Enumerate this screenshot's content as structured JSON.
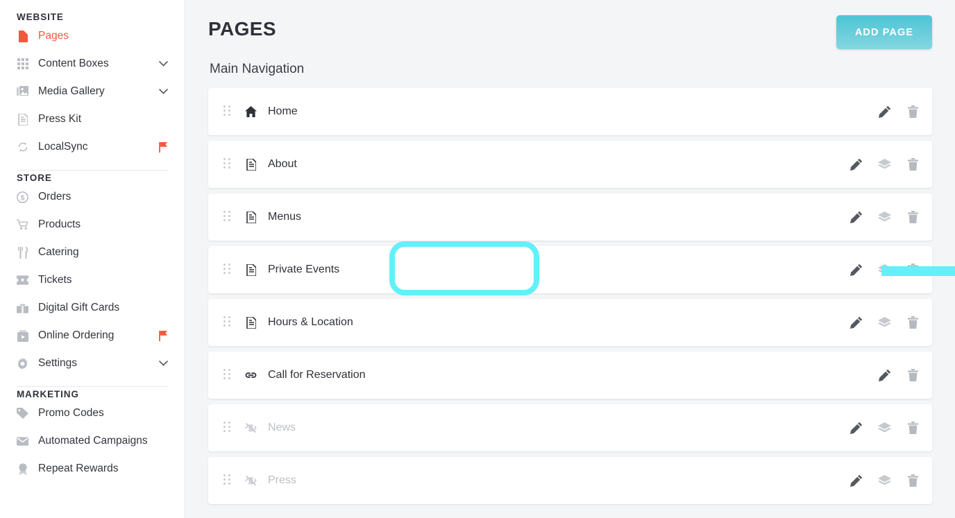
{
  "sidebar": {
    "sections": [
      {
        "title": "WEBSITE",
        "items": [
          {
            "label": "Pages",
            "icon": "page-filled-icon",
            "active": true,
            "trailing": "none"
          },
          {
            "label": "Content Boxes",
            "icon": "grid-icon",
            "active": false,
            "trailing": "chevron-down-icon"
          },
          {
            "label": "Media Gallery",
            "icon": "image-stack-icon",
            "active": false,
            "trailing": "chevron-down-icon"
          },
          {
            "label": "Press Kit",
            "icon": "document-icon",
            "active": false,
            "trailing": "none"
          },
          {
            "label": "LocalSync",
            "icon": "sync-icon",
            "active": false,
            "trailing": "flag-icon"
          }
        ]
      },
      {
        "title": "STORE",
        "items": [
          {
            "label": "Orders",
            "icon": "dollar-circle-icon",
            "active": false,
            "trailing": "none"
          },
          {
            "label": "Products",
            "icon": "cart-icon",
            "active": false,
            "trailing": "none"
          },
          {
            "label": "Catering",
            "icon": "utensils-icon",
            "active": false,
            "trailing": "none"
          },
          {
            "label": "Tickets",
            "icon": "ticket-icon",
            "active": false,
            "trailing": "none"
          },
          {
            "label": "Digital Gift Cards",
            "icon": "gift-card-icon",
            "active": false,
            "trailing": "none"
          },
          {
            "label": "Online Ordering",
            "icon": "bag-play-icon",
            "active": false,
            "trailing": "flag-icon"
          },
          {
            "label": "Settings",
            "icon": "gear-icon",
            "active": false,
            "trailing": "chevron-down-icon"
          }
        ]
      },
      {
        "title": "MARKETING",
        "items": [
          {
            "label": "Promo Codes",
            "icon": "tag-icon",
            "active": false,
            "trailing": "none"
          },
          {
            "label": "Automated Campaigns",
            "icon": "envelope-icon",
            "active": false,
            "trailing": "none"
          },
          {
            "label": "Repeat Rewards",
            "icon": "award-icon",
            "active": false,
            "trailing": "none"
          }
        ]
      }
    ]
  },
  "main": {
    "title": "PAGES",
    "add_page_label": "ADD PAGE",
    "subhead": "Main Navigation",
    "rows": [
      {
        "label": "Home",
        "icon": "home-icon",
        "hidden": false,
        "actions": [
          "edit-icon",
          "trash-icon"
        ]
      },
      {
        "label": "About",
        "icon": "document-icon",
        "hidden": false,
        "actions": [
          "edit-icon",
          "layers-icon",
          "trash-icon"
        ]
      },
      {
        "label": "Menus",
        "icon": "document-icon",
        "hidden": false,
        "actions": [
          "edit-icon",
          "layers-icon",
          "trash-icon"
        ]
      },
      {
        "label": "Private Events",
        "icon": "document-icon",
        "hidden": false,
        "actions": [
          "edit-icon",
          "layers-icon",
          "trash-icon"
        ]
      },
      {
        "label": "Hours & Location",
        "icon": "document-icon",
        "hidden": false,
        "actions": [
          "edit-icon",
          "layers-icon",
          "trash-icon"
        ]
      },
      {
        "label": "Call for Reservation",
        "icon": "link-icon",
        "hidden": false,
        "actions": [
          "edit-icon",
          "trash-icon"
        ]
      },
      {
        "label": "News",
        "icon": "eye-off-icon",
        "hidden": true,
        "actions": [
          "edit-icon",
          "layers-icon",
          "trash-icon"
        ]
      },
      {
        "label": "Press",
        "icon": "eye-off-icon",
        "hidden": true,
        "actions": [
          "edit-icon",
          "layers-icon",
          "trash-icon"
        ]
      }
    ]
  },
  "annotations": {
    "highlight_target": "Private Events",
    "arrow_target": "edit-icon",
    "color": "#62F0FA"
  },
  "colors": {
    "accent_orange": "#F05A3C",
    "button_teal": "#4CC5D5",
    "annotation_cyan": "#62F0FA",
    "text_dark": "#2E3138",
    "bg_gray": "#F4F5F6"
  }
}
